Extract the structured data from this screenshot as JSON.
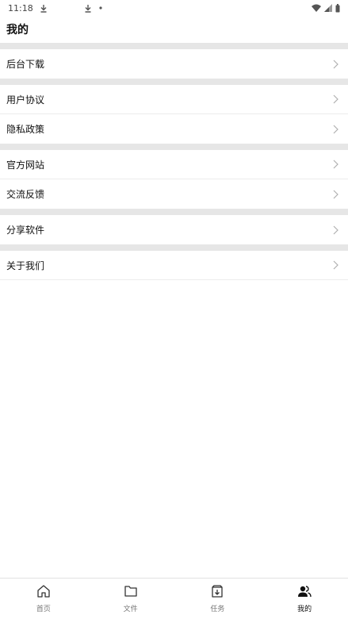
{
  "status_bar": {
    "time": "11:18"
  },
  "header": {
    "title": "我的"
  },
  "menu": {
    "background_download": "后台下载",
    "user_agreement": "用户协议",
    "privacy_policy": "隐私政策",
    "official_website": "官方网站",
    "feedback": "交流反馈",
    "share_software": "分享软件",
    "about_us": "关于我们"
  },
  "tabs": [
    {
      "label": "首页",
      "icon": "home-icon"
    },
    {
      "label": "文件",
      "icon": "folder-icon"
    },
    {
      "label": "任务",
      "icon": "task-download-icon"
    },
    {
      "label": "我的",
      "icon": "users-icon",
      "active": true
    }
  ],
  "colors": {
    "separator": "#e6e6e6",
    "chevron": "#b0b0b0",
    "active_tab": "#111111",
    "inactive_tab": "#777777"
  }
}
